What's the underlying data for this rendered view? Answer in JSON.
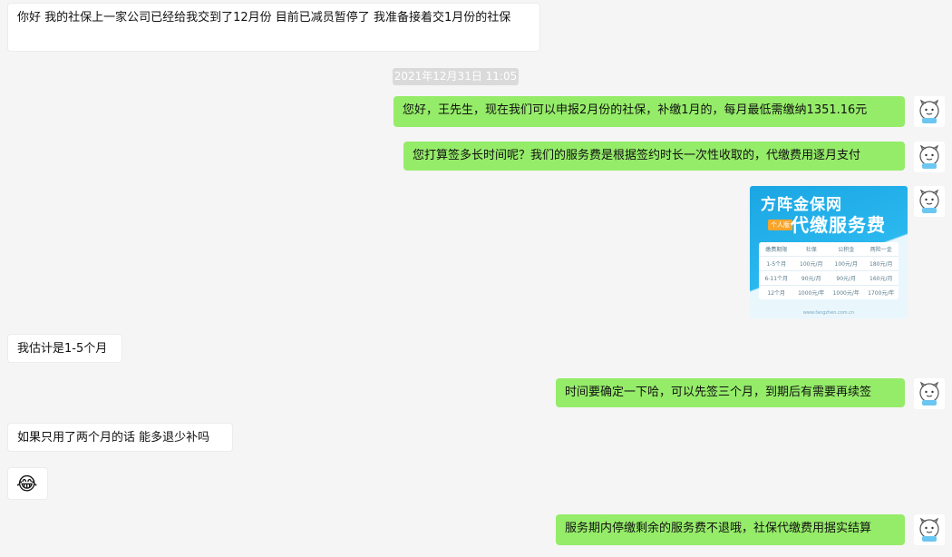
{
  "messages": [
    {
      "text": "你好 我的社保上一家公司已经给我交到了12月份 目前已减员暂停了 我准备接着交1月份的社保"
    },
    {
      "timestamp": "2021年12月31日 11:05"
    },
    {
      "text": "您好，王先生，现在我们可以申报2月份的社保，补缴1月的，每月最低需缴纳1351.16元"
    },
    {
      "text": "您打算签多长时间呢？我们的服务费是根据签约时长一次性收取的，代缴费用逐月支付"
    },
    {
      "image": {
        "title1": "方阵金保网",
        "title2": "代缴服务费",
        "badge": "个人版",
        "table": {
          "headers": [
            "缴费期限",
            "社保",
            "公积金",
            "两险一金"
          ],
          "rows": [
            [
              "1-5个月",
              "100元/月",
              "100元/月",
              "180元/月"
            ],
            [
              "6-11个月",
              "90元/月",
              "90元/月",
              "160元/月"
            ],
            [
              "12个月",
              "1000元/年",
              "1000元/年",
              "1700元/年"
            ]
          ]
        },
        "footer": "www.fangzhen.com.cn"
      }
    },
    {
      "text": "我估计是1-5个月"
    },
    {
      "text": "时间要确定一下哈，可以先签三个月，到期后有需要再续签"
    },
    {
      "text": "如果只用了两个月的话 能多退少补吗"
    },
    {
      "emoji": "😂"
    },
    {
      "text": "服务期内停缴剩余的服务费不退哦，社保代缴费用据实结算"
    }
  ]
}
